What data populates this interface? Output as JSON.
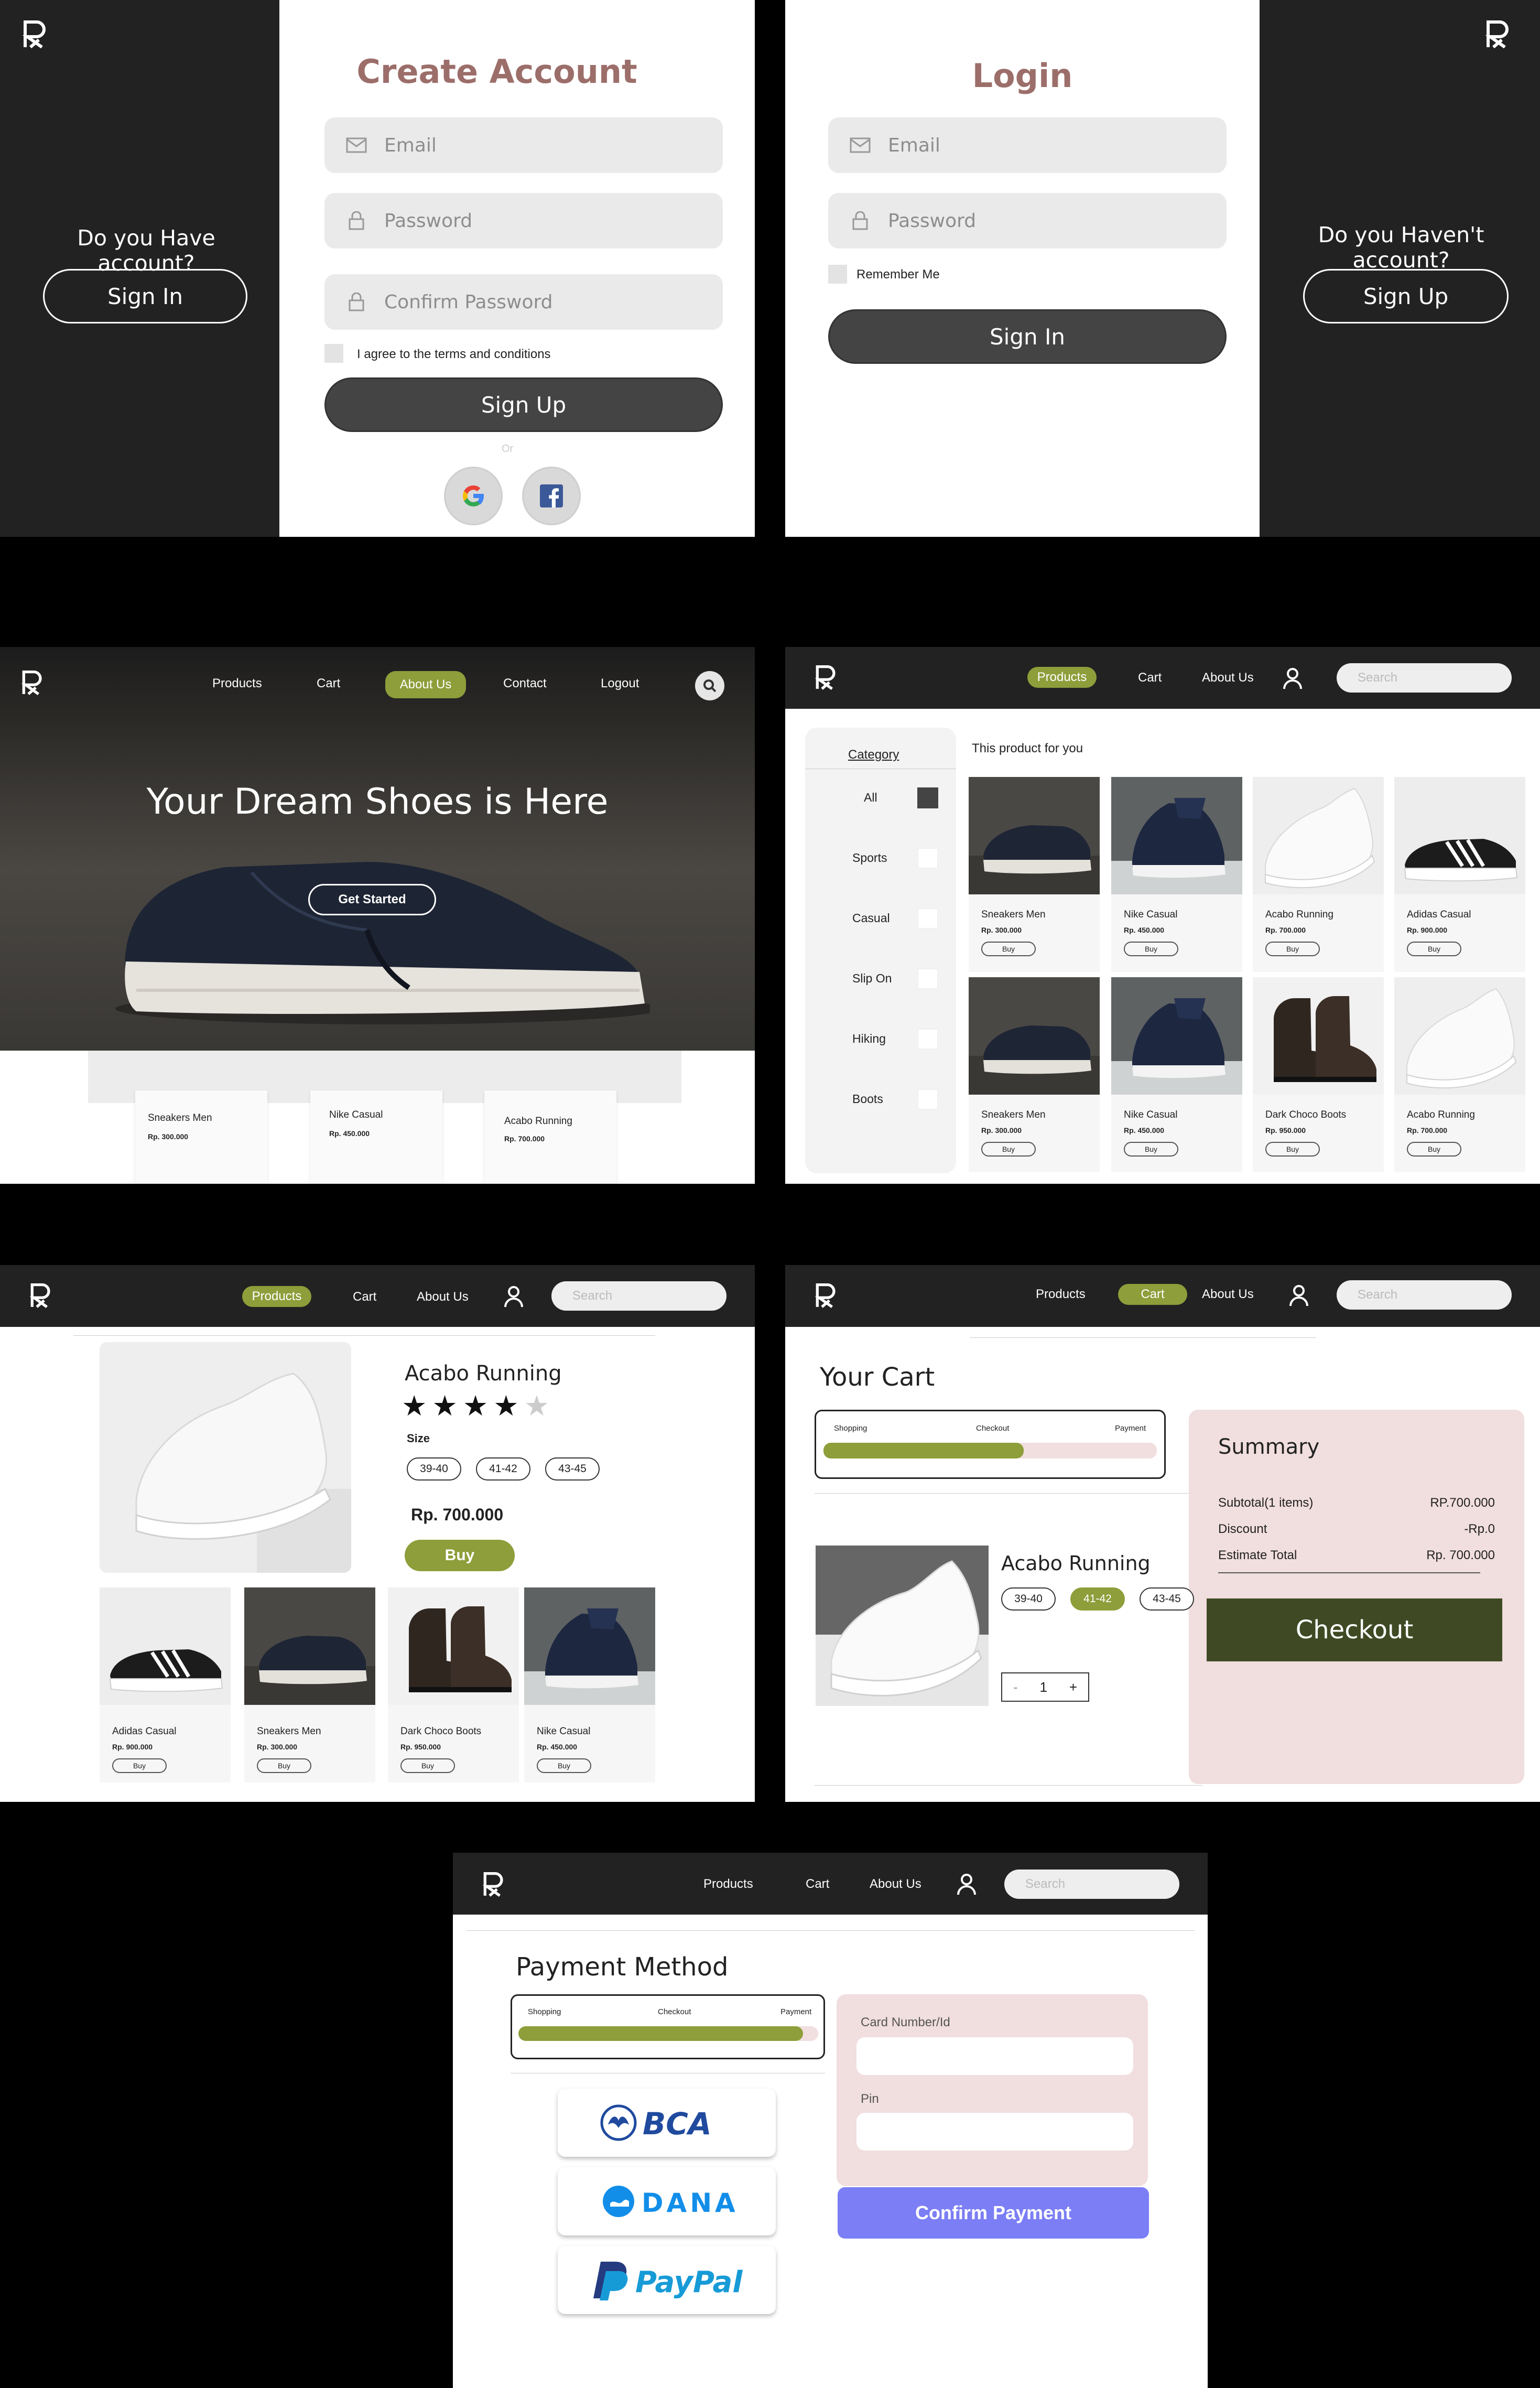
{
  "signup": {
    "title": "Create Account",
    "email_placeholder": "Email",
    "password_placeholder": "Password",
    "confirm_placeholder": "Confirm Password",
    "terms_label": "I agree to the terms and conditions",
    "signup_button": "Sign Up",
    "or_label": "Or",
    "side_question": "Do you Have account?",
    "side_button": "Sign In"
  },
  "login": {
    "title": "Login",
    "email_placeholder": "Email",
    "password_placeholder": "Password",
    "remember_label": "Remember Me",
    "signin_button": "Sign In",
    "side_question": "Do you Haven't account?",
    "side_button": "Sign Up"
  },
  "home": {
    "nav": [
      "Products",
      "Cart",
      "About Us",
      "Contact",
      "Logout"
    ],
    "active_nav": "About Us",
    "hero_title": "Your Dream Shoes is Here",
    "hero_button": "Get Started",
    "cards": [
      {
        "name": "Sneakers Men",
        "price": "Rp. 300.000"
      },
      {
        "name": "Nike Casual",
        "price": "Rp. 450.000"
      },
      {
        "name": "Acabo Running",
        "price": "Rp. 700.000"
      }
    ]
  },
  "products": {
    "nav": [
      "Products",
      "Cart",
      "About Us"
    ],
    "search_placeholder": "Search",
    "category_title": "Category",
    "categories": [
      "All",
      "Sports",
      "Casual",
      "Slip On",
      "Hiking",
      "Boots"
    ],
    "heading": "This product for you",
    "items": [
      {
        "name": "Sneakers Men",
        "price": "Rp. 300.000",
        "buy": "Buy",
        "img": "sneaker-dark"
      },
      {
        "name": "Nike Casual",
        "price": "Rp. 450.000",
        "buy": "Buy",
        "img": "nike-navy"
      },
      {
        "name": "Acabo Running",
        "price": "Rp. 700.000",
        "buy": "Buy",
        "img": "running-white"
      },
      {
        "name": "Adidas Casual",
        "price": "Rp. 900.000",
        "buy": "Buy",
        "img": "adidas-black"
      },
      {
        "name": "Sneakers Men",
        "price": "Rp. 300.000",
        "buy": "Buy",
        "img": "sneaker-dark"
      },
      {
        "name": "Nike Casual",
        "price": "Rp. 450.000",
        "buy": "Buy",
        "img": "nike-navy"
      },
      {
        "name": "Dark Choco Boots",
        "price": "Rp. 950.000",
        "buy": "Buy",
        "img": "boots-brown"
      },
      {
        "name": "Acabo Running",
        "price": "Rp. 700.000",
        "buy": "Buy",
        "img": "running-white"
      }
    ]
  },
  "detail": {
    "nav": [
      "Products",
      "Cart",
      "About Us"
    ],
    "search_placeholder": "Search",
    "name": "Acabo Running",
    "rating": 4,
    "rating_max": 5,
    "size_label": "Size",
    "sizes": [
      "39-40",
      "41-42",
      "43-45"
    ],
    "price": "Rp. 700.000",
    "buy": "Buy",
    "related": [
      {
        "name": "Adidas Casual",
        "price": "Rp. 900.000",
        "buy": "Buy",
        "img": "adidas-black"
      },
      {
        "name": "Sneakers Men",
        "price": "Rp. 300.000",
        "buy": "Buy",
        "img": "sneaker-dark"
      },
      {
        "name": "Dark Choco Boots",
        "price": "Rp. 950.000",
        "buy": "Buy",
        "img": "boots-brown"
      },
      {
        "name": "Nike Casual",
        "price": "Rp. 450.000",
        "buy": "Buy",
        "img": "nike-navy"
      }
    ]
  },
  "cart": {
    "nav": [
      "Products",
      "Cart",
      "About Us"
    ],
    "search_placeholder": "Search",
    "title": "Your Cart",
    "steps": [
      "Shopping",
      "Checkout",
      "Payment"
    ],
    "progress": 0.6,
    "item_name": "Acabo Running",
    "sizes": [
      "39-40",
      "41-42",
      "43-45"
    ],
    "selected_size": "41-42",
    "qty": "1",
    "qty_minus": "-",
    "qty_plus": "+",
    "summary_title": "Summary",
    "summary_rows": [
      {
        "label": "Subtotal(1 items)",
        "value": "RP.700.000"
      },
      {
        "label": "Discount",
        "value": "-Rp.0"
      },
      {
        "label": "Estimate Total",
        "value": "Rp. 700.000"
      }
    ],
    "checkout": "Checkout"
  },
  "payment": {
    "nav": [
      "Products",
      "Cart",
      "About Us"
    ],
    "search_placeholder": "Search",
    "title": "Payment Method",
    "steps": [
      "Shopping",
      "Checkout",
      "Payment"
    ],
    "progress": 0.95,
    "methods": [
      "BCA",
      "DANA",
      "PayPal"
    ],
    "card_label": "Card Number/Id",
    "pin_label": "Pin",
    "confirm": "Confirm Payment"
  },
  "colors": {
    "accent_green": "#8d9e3a",
    "title_brown": "#9c6e6a",
    "checkout_green": "#3f4a24",
    "summary_pink": "#f1dede",
    "confirm_blue": "#7b7ef5"
  }
}
